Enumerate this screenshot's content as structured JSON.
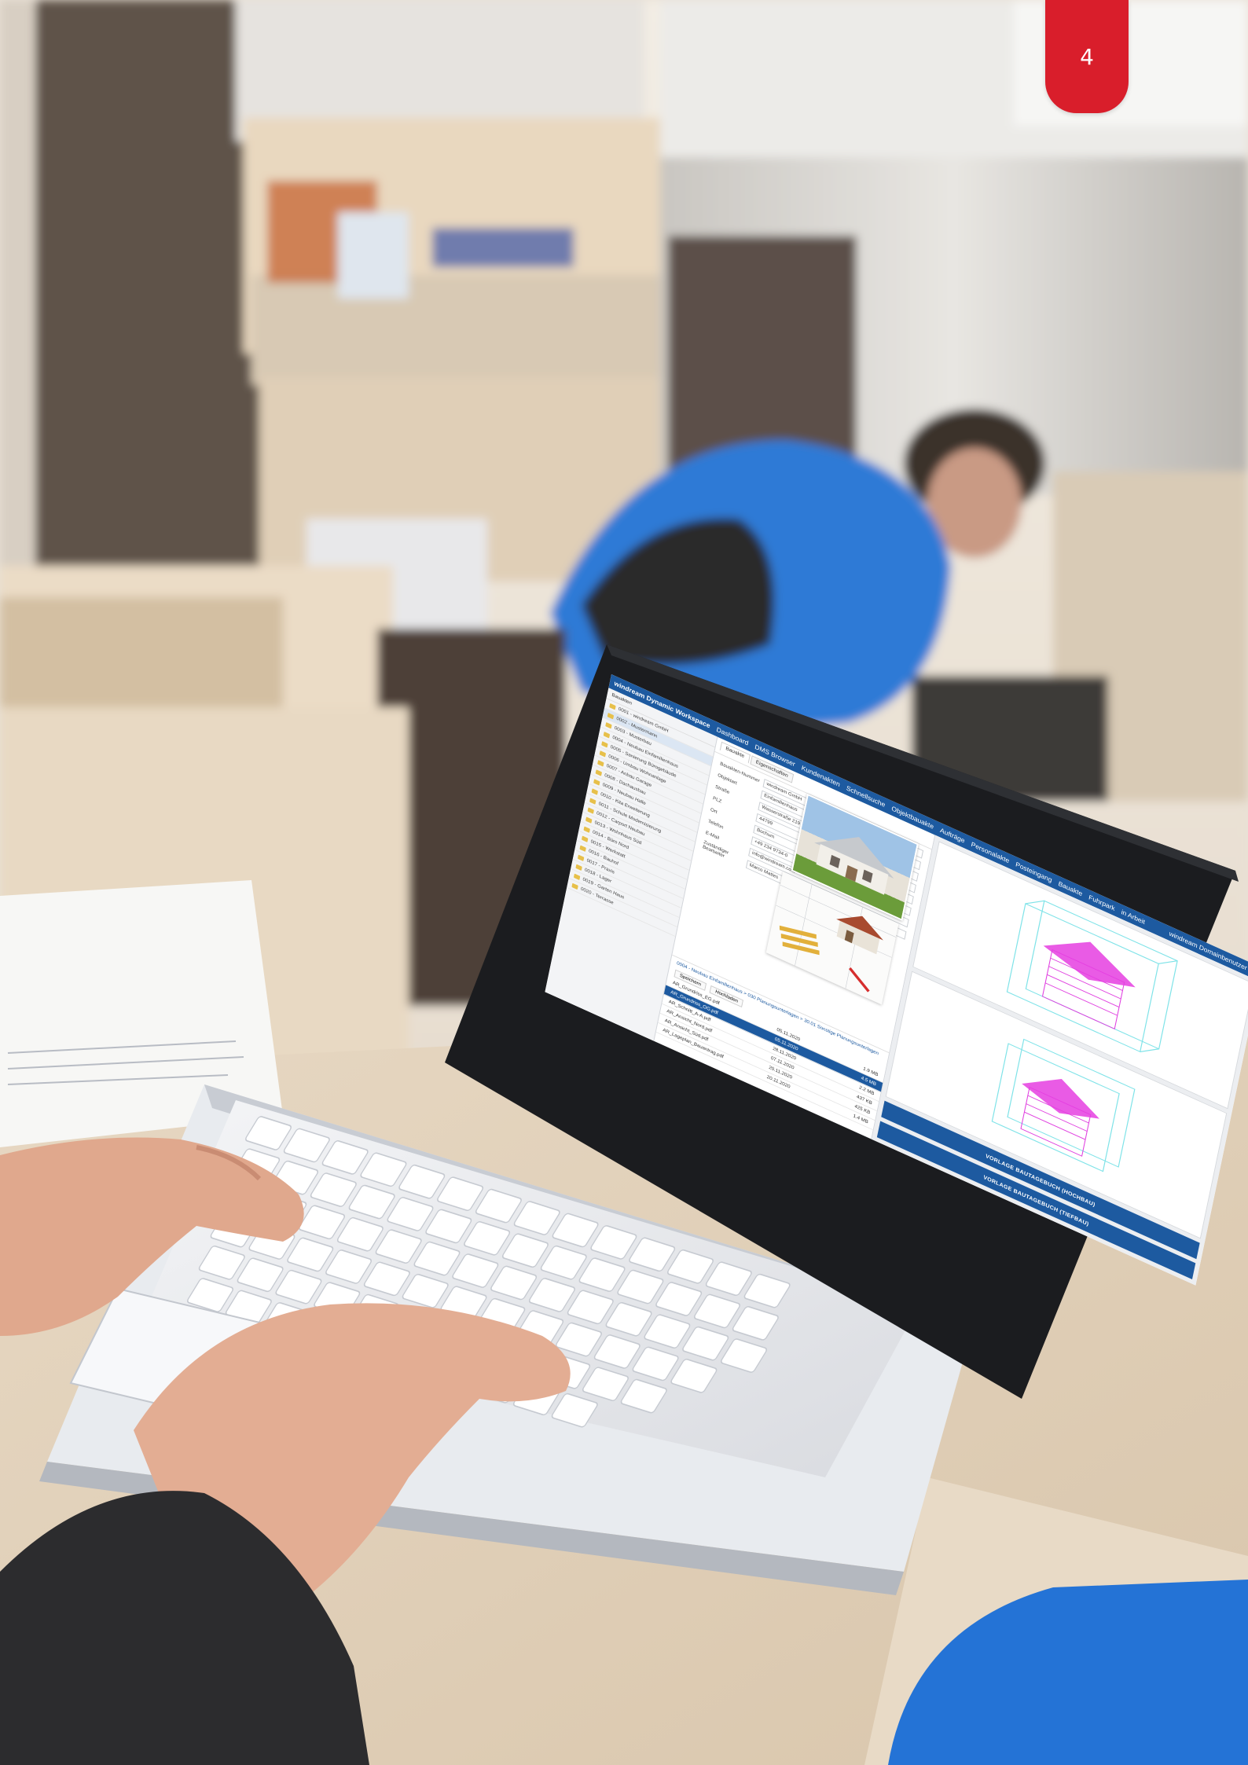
{
  "page": {
    "number": "4",
    "badge_color": "#d91e2b"
  },
  "screen": {
    "app_title": "windream Dynamic Workspace",
    "nav_items": [
      "Dashboard",
      "DMS Browser",
      "Kundenakten",
      "Schnellsuche",
      "Objektbauakte",
      "Aufträge",
      "Personalakte",
      "Posteingang",
      "Bauakte",
      "Fuhrpark",
      "in Arbeit"
    ],
    "user_label": "windream Domainbenutzer",
    "sidebar_head": "Bauakten",
    "sidebar_items": [
      "0001 - windream GmbH",
      "0002 - Mustermann",
      "0003 - Musterbau",
      "0004 - Neubau Einfamilienhaus",
      "0005 - Sanierung Bürogebäude",
      "0006 - Umbau Wohnanlage",
      "0007 - Anbau Garage",
      "0008 - Dachausbau",
      "0009 - Neubau Halle",
      "0010 - Kita Erweiterung",
      "0011 - Schule Modernisierung",
      "0012 - Carport Neubau",
      "0013 - Wohnhaus Süd",
      "0014 - Büro Nord",
      "0015 - Werkstatt",
      "0016 - Bauhof",
      "0017 - Praxis",
      "0018 - Lager",
      "0019 - Garten Haus",
      "0020 - Terrasse"
    ],
    "tabs": [
      "Bauakte",
      "Eigenschaften"
    ],
    "form": [
      {
        "label": "Bauakten-Nummer",
        "value": "windream GmbH"
      },
      {
        "label": "Objektart",
        "value": "Einfamilienhaus"
      },
      {
        "label": "Straße",
        "value": "Wasserstraße 219"
      },
      {
        "label": "PLZ",
        "value": "44799"
      },
      {
        "label": "Ort",
        "value": "Bochum"
      },
      {
        "label": "Telefon",
        "value": "+49 234 9734-0"
      },
      {
        "label": "E-Mail",
        "value": "info@windream.com"
      },
      {
        "label": "Zuständiger Bearbeiter",
        "value": "Marco Mattes"
      }
    ],
    "breadcrumb": "0004 - Neubau Einfamilienhaus > 030 Planungsunterlagen > 30.01 Sonstige Planungsunterlagen",
    "actions": [
      "Speichern",
      "Hochladen"
    ],
    "files": [
      {
        "name": "AR_Grundriss_EG.pdf",
        "date": "05.11.2020",
        "size": "1.9 MB"
      },
      {
        "name": "AR_Grundriss_OG.pdf",
        "date": "05.11.2020",
        "size": "4.5 MB"
      },
      {
        "name": "AR_Schnitt_A-A.pdf",
        "date": "28.11.2020",
        "size": "2.2 MB"
      },
      {
        "name": "AR_Ansicht_Nord.pdf",
        "date": "07.11.2020",
        "size": "437 KB"
      },
      {
        "name": "AR_Ansicht_Süd.pdf",
        "date": "20.11.2020",
        "size": "425 KB"
      },
      {
        "name": "AR_Lageplan_Bauantrag.pdf",
        "date": "20.11.2020",
        "size": "1.4 MB"
      }
    ],
    "template_buttons": [
      "VORLAGE BAUTAGEBUCH (HOCHBAU)",
      "VORLAGE BAUTAGEBUCH (TIEFBAU)"
    ],
    "accent": "#1d5aa0"
  }
}
